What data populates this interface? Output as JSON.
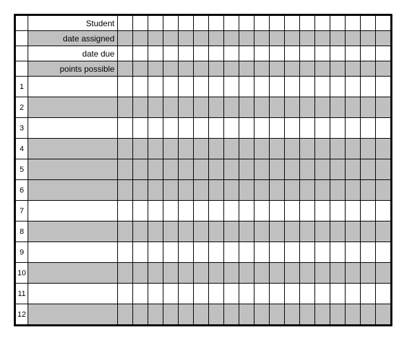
{
  "header": {
    "rows": [
      {
        "label": "Student",
        "shade": "white"
      },
      {
        "label": "date assigned",
        "shade": "gray"
      },
      {
        "label": "date due",
        "shade": "white"
      },
      {
        "label": "points possible",
        "shade": "gray"
      }
    ]
  },
  "data_columns": 18,
  "data_rows": [
    {
      "num": "1",
      "shade": "white"
    },
    {
      "num": "2",
      "shade": "gray"
    },
    {
      "num": "3",
      "shade": "white"
    },
    {
      "num": "4",
      "shade": "gray"
    },
    {
      "num": "5",
      "shade": "gray"
    },
    {
      "num": "6",
      "shade": "gray"
    },
    {
      "num": "7",
      "shade": "white"
    },
    {
      "num": "8",
      "shade": "gray"
    },
    {
      "num": "9",
      "shade": "white"
    },
    {
      "num": "10",
      "shade": "gray"
    },
    {
      "num": "11",
      "shade": "white"
    },
    {
      "num": "12",
      "shade": "gray"
    }
  ]
}
